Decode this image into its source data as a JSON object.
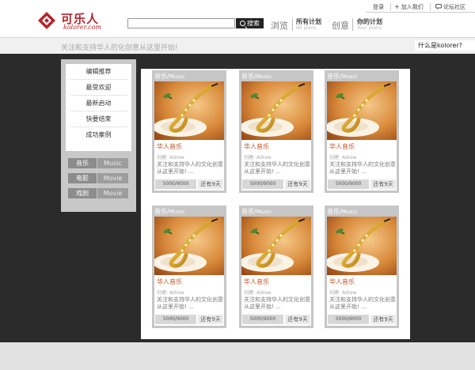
{
  "brand": {
    "name_cn": "可乐人",
    "name_en": "kolorer.com",
    "color": "#b4262b"
  },
  "top_links": [
    {
      "label": "登录",
      "icon": ""
    },
    {
      "label": "加入我们",
      "icon": "plus-icon"
    },
    {
      "label": "论坛社区",
      "icon": "chat-icon"
    }
  ],
  "search": {
    "value": "",
    "button_label": "搜索",
    "button_icon": "magnifier-icon"
  },
  "nav": {
    "browse": "浏览",
    "all_plans_cn": "所有计划",
    "all_plans_en": "All plans",
    "create": "创意",
    "your_plans_cn": "你的计划",
    "your_plans_en": "Your plans"
  },
  "tagline": "关注和支持华人的化创意从这里开始!",
  "what_is": "什么是kolorer?",
  "sidebar": {
    "menu": [
      {
        "label": "编辑推荐"
      },
      {
        "label": "最受欢迎"
      },
      {
        "label": "最新启动"
      },
      {
        "label": "快要结束"
      },
      {
        "label": "成功案例"
      }
    ],
    "categories": [
      {
        "cn": "音乐",
        "en": "Music"
      },
      {
        "cn": "电影",
        "en": "Movie"
      },
      {
        "cn": "戏剧",
        "en": "Movie"
      }
    ]
  },
  "cards": [
    {
      "cat_cn": "音乐",
      "cat_en": "Music",
      "image_icon": "saxophone-image",
      "title": "华人音乐",
      "creator_label": "创建:",
      "creator": "Adrew",
      "desc": "关注和支持华人的文化创意从这里开始! ...",
      "progress": "5000/9000",
      "days_left": "还有9天"
    },
    {
      "cat_cn": "音乐",
      "cat_en": "Music",
      "image_icon": "saxophone-image",
      "title": "华人音乐",
      "creator_label": "创建:",
      "creator": "Adrew",
      "desc": "关注和支持华人的文化创意从这里开始! ...",
      "progress": "5000/9000",
      "days_left": "还有9天"
    },
    {
      "cat_cn": "音乐",
      "cat_en": "Music",
      "image_icon": "saxophone-image",
      "title": "华人音乐",
      "creator_label": "创建:",
      "creator": "Adrew",
      "desc": "关注和支持华人的文化创意从这里开始! ...",
      "progress": "5000/9000",
      "days_left": "还有9天"
    },
    {
      "cat_cn": "音乐",
      "cat_en": "Music",
      "image_icon": "saxophone-image",
      "title": "华人音乐",
      "creator_label": "创建:",
      "creator": "Adrew",
      "desc": "关注和支持华人的文化创意从这里开始! ...",
      "progress": "5000/9000",
      "days_left": "还有9天"
    },
    {
      "cat_cn": "音乐",
      "cat_en": "Music",
      "image_icon": "saxophone-image",
      "title": "华人音乐",
      "creator_label": "创建:",
      "creator": "Adrew",
      "desc": "关注和支持华人的文化创意从这里开始! ...",
      "progress": "5000/9000",
      "days_left": "还有9天"
    },
    {
      "cat_cn": "音乐",
      "cat_en": "Music",
      "image_icon": "saxophone-image",
      "title": "华人音乐",
      "creator_label": "创建:",
      "creator": "Adrew",
      "desc": "关注和支持华人的文化创意从这里开始! ...",
      "progress": "5000/9000",
      "days_left": "还有9天"
    }
  ],
  "colors": {
    "page_bg": "#2b2b2b",
    "accent_red": "#b4262b",
    "card_title": "#c0501e",
    "card_frame": "#c6c6c6"
  }
}
